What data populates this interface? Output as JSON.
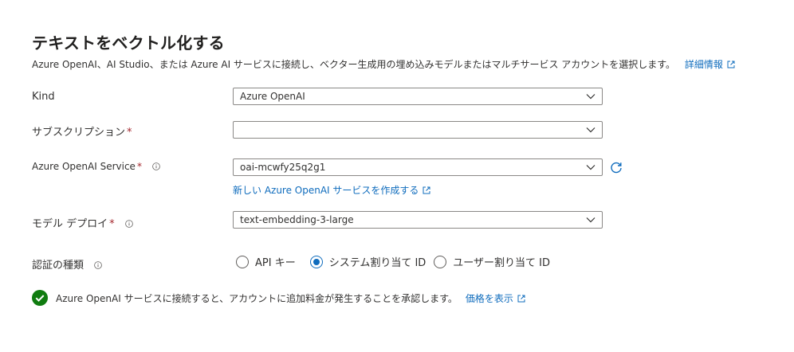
{
  "title": "テキストをベクトル化する",
  "description": {
    "text": "Azure OpenAI、AI Studio、または Azure AI サービスに接続し、ベクター生成用の埋め込みモデルまたはマルチサービス アカウントを選択します。",
    "link": "詳細情報"
  },
  "kind": {
    "label": "Kind",
    "value": "Azure OpenAI"
  },
  "subscription": {
    "label": "サブスクリプション",
    "required": "*",
    "value": ""
  },
  "openai_service": {
    "label": "Azure OpenAI Service",
    "required": "*",
    "value": "oai-mcwfy25q2g1",
    "create_link": "新しい Azure OpenAI サービスを作成する"
  },
  "model_deploy": {
    "label": "モデル デプロイ",
    "required": "*",
    "value": "text-embedding-3-large"
  },
  "auth": {
    "label": "認証の種類",
    "options": [
      "API キー",
      "システム割り当て ID",
      "ユーザー割り当て ID"
    ],
    "selected": "システム割り当て ID"
  },
  "acknowledge": {
    "text": "Azure OpenAI サービスに接続すると、アカウントに追加料金が発生することを承認します。",
    "link": "価格を表示"
  },
  "colors": {
    "link": "#0f6cbd",
    "required": "#a4262c",
    "check": "#107c10"
  },
  "icons": [
    "external-link-icon",
    "info-icon",
    "chevron-down-icon",
    "refresh-icon",
    "checkmark-circle-icon"
  ]
}
